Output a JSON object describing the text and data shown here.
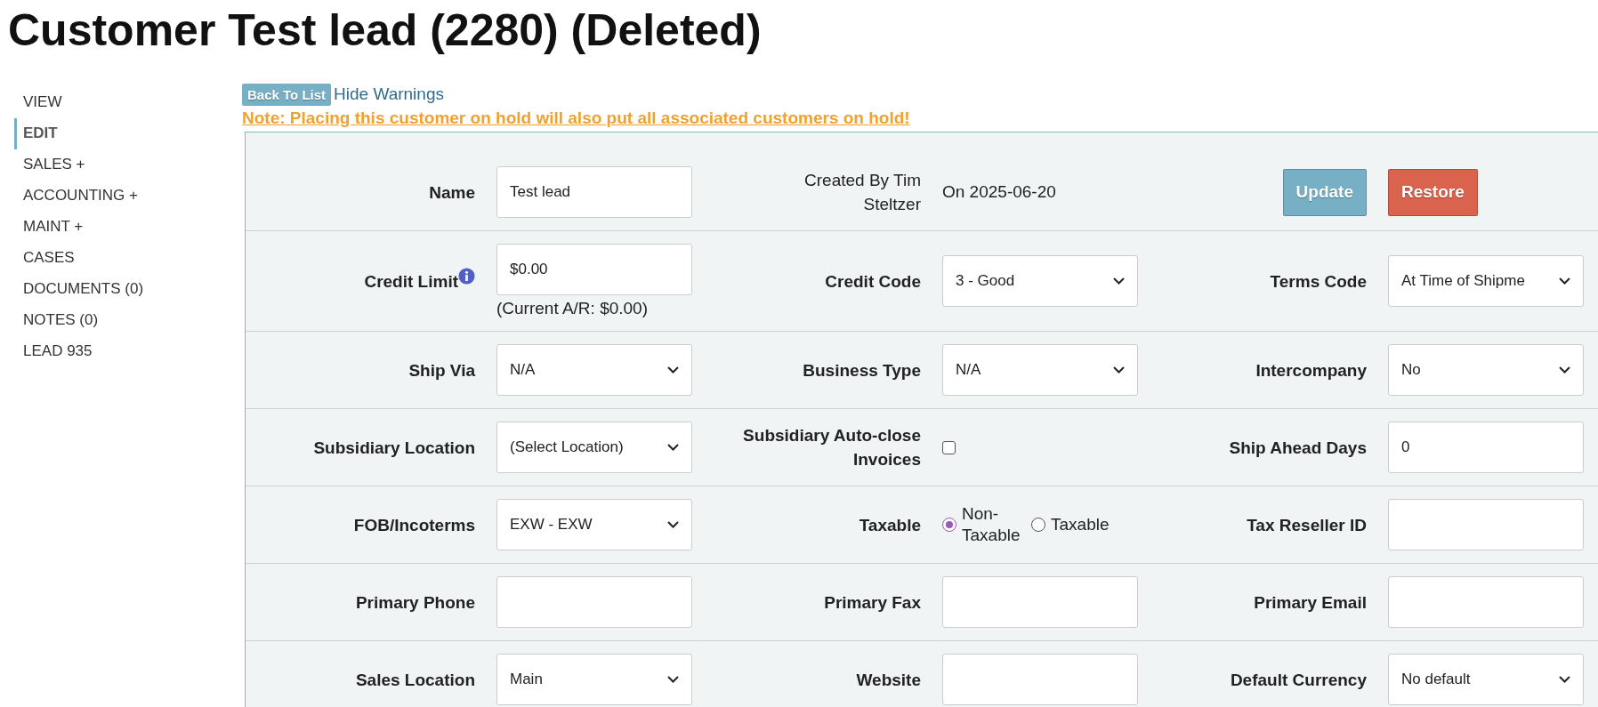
{
  "title": "Customer Test lead (2280) (Deleted)",
  "sidebar": {
    "items": [
      {
        "label": "VIEW",
        "selected": false
      },
      {
        "label": "EDIT",
        "selected": true
      },
      {
        "label": "SALES +",
        "selected": false
      },
      {
        "label": "ACCOUNTING +",
        "selected": false
      },
      {
        "label": "MAINT +",
        "selected": false
      },
      {
        "label": "CASES",
        "selected": false
      },
      {
        "label": "DOCUMENTS (0)",
        "selected": false
      },
      {
        "label": "NOTES (0)",
        "selected": false
      },
      {
        "label": "LEAD 935",
        "selected": false
      }
    ]
  },
  "toolbar": {
    "back_button": "Back To List",
    "hide_link": "Hide Warnings",
    "note": "Note: Placing this customer on hold will also put all associated customers on hold!"
  },
  "form": {
    "rows": [
      {
        "pairs": [
          {
            "kind": "field",
            "label": "Name",
            "control": {
              "kind": "input",
              "value": "Test lead"
            }
          },
          {
            "kind": "info",
            "label": "Created By Tim Steltzer",
            "value": "On 2025-06-20"
          },
          {
            "kind": "actions",
            "buttons": [
              {
                "label": "Update",
                "kind": "primary"
              },
              {
                "label": "Restore",
                "kind": "danger"
              }
            ]
          }
        ]
      },
      {
        "pairs": [
          {
            "kind": "field",
            "label": "Credit Limit",
            "info_icon": true,
            "control": {
              "kind": "input",
              "value": "$0.00",
              "note": "(Current A/R: $0.00)"
            }
          },
          {
            "kind": "field",
            "label": "Credit Code",
            "control": {
              "kind": "select",
              "value": "3 - Good"
            }
          },
          {
            "kind": "field",
            "label": "Terms Code",
            "control": {
              "kind": "select",
              "value": "At Time of Shipme"
            }
          }
        ]
      },
      {
        "pairs": [
          {
            "kind": "field",
            "label": "Ship Via",
            "control": {
              "kind": "select",
              "value": "N/A"
            }
          },
          {
            "kind": "field",
            "label": "Business Type",
            "control": {
              "kind": "select",
              "value": "N/A"
            }
          },
          {
            "kind": "field",
            "label": "Intercompany",
            "control": {
              "kind": "select",
              "value": "No"
            }
          }
        ]
      },
      {
        "pairs": [
          {
            "kind": "field",
            "label": "Subsidiary Location",
            "control": {
              "kind": "select",
              "value": "(Select Location)"
            }
          },
          {
            "kind": "field",
            "label": "Subsidiary Auto-close Invoices",
            "control": {
              "kind": "checkbox",
              "checked": false
            }
          },
          {
            "kind": "field",
            "label": "Ship Ahead Days",
            "control": {
              "kind": "input",
              "value": "0"
            }
          }
        ]
      },
      {
        "pairs": [
          {
            "kind": "field",
            "label": "FOB/Incoterms",
            "control": {
              "kind": "select",
              "value": "EXW - EXW"
            }
          },
          {
            "kind": "field",
            "label": "Taxable",
            "control": {
              "kind": "radio",
              "options": [
                {
                  "label": "Non-Taxable",
                  "selected": true
                },
                {
                  "label": "Taxable",
                  "selected": false
                }
              ]
            }
          },
          {
            "kind": "field",
            "label": "Tax Reseller ID",
            "control": {
              "kind": "input"
            }
          }
        ]
      },
      {
        "pairs": [
          {
            "kind": "field",
            "label": "Primary Phone",
            "control": {
              "kind": "input"
            }
          },
          {
            "kind": "field",
            "label": "Primary Fax",
            "control": {
              "kind": "input"
            }
          },
          {
            "kind": "field",
            "label": "Primary Email",
            "control": {
              "kind": "input"
            }
          }
        ]
      },
      {
        "pairs": [
          {
            "kind": "field",
            "label": "Sales Location",
            "control": {
              "kind": "select",
              "value": "Main"
            }
          },
          {
            "kind": "field",
            "label": "Website",
            "control": {
              "kind": "input"
            }
          },
          {
            "kind": "field",
            "label": "Default Currency",
            "control": {
              "kind": "select",
              "value": "No default"
            }
          }
        ]
      }
    ]
  }
}
